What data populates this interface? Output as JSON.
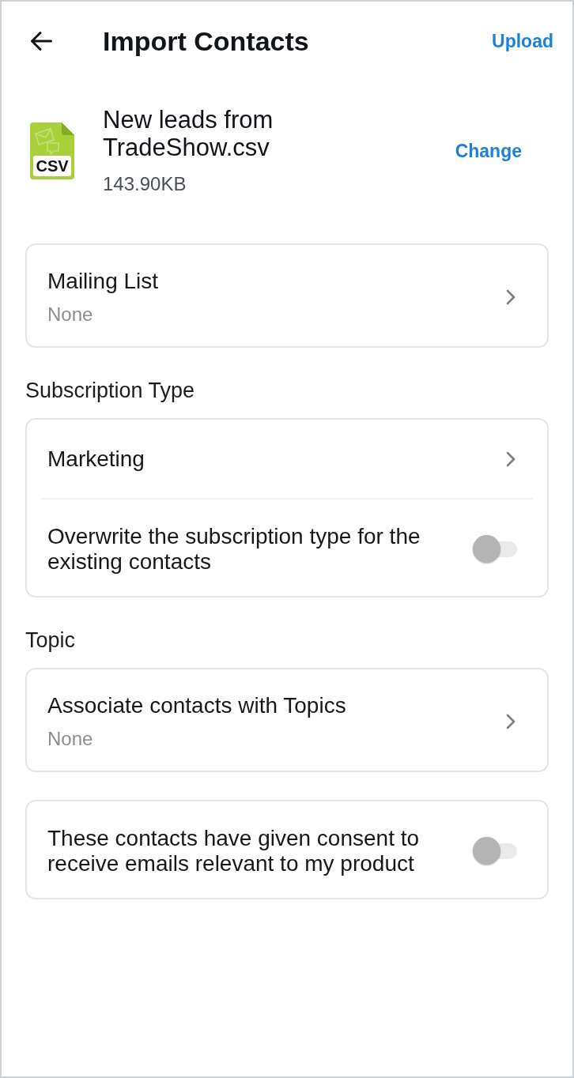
{
  "header": {
    "title": "Import Contacts",
    "action": "Upload"
  },
  "file": {
    "type_label": "CSV",
    "name": "New leads from TradeShow.csv",
    "size": "143.90KB",
    "action": "Change"
  },
  "sections": [
    {
      "rows": [
        {
          "kind": "select",
          "label": "Mailing List",
          "value": "None"
        }
      ]
    },
    {
      "heading": "Subscription Type",
      "rows": [
        {
          "kind": "select",
          "label": "Marketing"
        },
        {
          "kind": "toggle",
          "label": "Overwrite the subscription type for the existing contacts",
          "on": false
        }
      ]
    },
    {
      "heading": "Topic",
      "rows": [
        {
          "kind": "select",
          "label": "Associate contacts with Topics",
          "value": "None"
        }
      ]
    },
    {
      "rows": [
        {
          "kind": "toggle",
          "label": "These contacts have given consent to receive emails relevant to my product",
          "on": false
        }
      ]
    }
  ]
}
